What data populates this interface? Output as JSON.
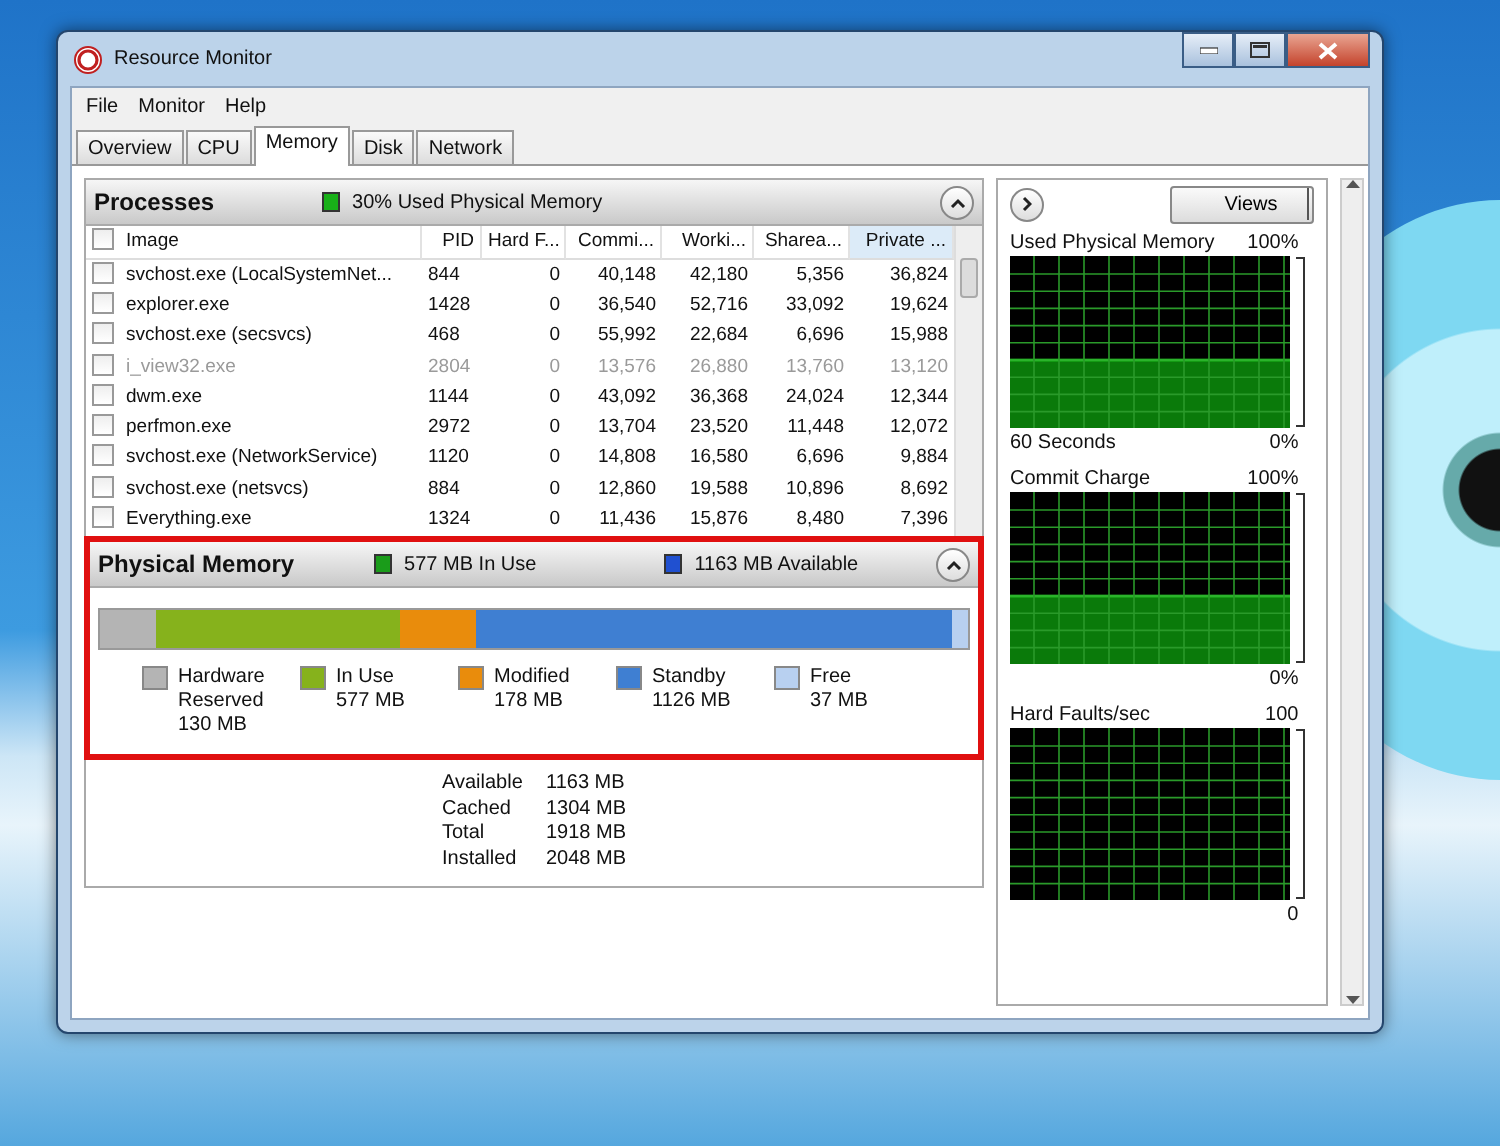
{
  "window": {
    "title": "Resource Monitor"
  },
  "menu": [
    "File",
    "Monitor",
    "Help"
  ],
  "tabs": [
    {
      "label": "Overview",
      "selected": false
    },
    {
      "label": "CPU",
      "selected": false
    },
    {
      "label": "Memory",
      "selected": true
    },
    {
      "label": "Disk",
      "selected": false
    },
    {
      "label": "Network",
      "selected": false
    }
  ],
  "processes": {
    "title": "Processes",
    "indicator": "30% Used Physical Memory",
    "select_all_checked": false,
    "columns": [
      {
        "label": "Image",
        "sorted": false
      },
      {
        "label": "PID",
        "sorted": false
      },
      {
        "label": "Hard F...",
        "sorted": false
      },
      {
        "label": "Commi...",
        "sorted": false
      },
      {
        "label": "Worki...",
        "sorted": false
      },
      {
        "label": "Sharea...",
        "sorted": false
      },
      {
        "label": "Private ...",
        "sorted": true
      }
    ],
    "rows": [
      {
        "checked": false,
        "disabled": false,
        "cells": [
          "svchost.exe (LocalSystemNet...",
          "844",
          "0",
          "40,148",
          "42,180",
          "5,356",
          "36,824"
        ]
      },
      {
        "checked": false,
        "disabled": false,
        "cells": [
          "explorer.exe",
          "1428",
          "0",
          "36,540",
          "52,716",
          "33,092",
          "19,624"
        ]
      },
      {
        "checked": false,
        "disabled": false,
        "cells": [
          "svchost.exe (secsvcs)",
          "468",
          "0",
          "55,992",
          "22,684",
          "6,696",
          "15,988"
        ]
      },
      {
        "checked": false,
        "disabled": true,
        "cells": [
          "i_view32.exe",
          "2804",
          "0",
          "13,576",
          "26,880",
          "13,760",
          "13,120"
        ]
      },
      {
        "checked": false,
        "disabled": false,
        "cells": [
          "dwm.exe",
          "1144",
          "0",
          "43,092",
          "36,368",
          "24,024",
          "12,344"
        ]
      },
      {
        "checked": false,
        "disabled": false,
        "cells": [
          "perfmon.exe",
          "2972",
          "0",
          "13,704",
          "23,520",
          "11,448",
          "12,072"
        ]
      },
      {
        "checked": false,
        "disabled": false,
        "cells": [
          "svchost.exe (NetworkService)",
          "1120",
          "0",
          "14,808",
          "16,580",
          "6,696",
          "9,884"
        ]
      },
      {
        "checked": false,
        "disabled": false,
        "cells": [
          "svchost.exe (netsvcs)",
          "884",
          "0",
          "12,860",
          "19,588",
          "10,896",
          "8,692"
        ]
      },
      {
        "checked": false,
        "disabled": false,
        "cells": [
          "Everything.exe",
          "1324",
          "0",
          "11,436",
          "15,876",
          "8,480",
          "7,396"
        ]
      }
    ]
  },
  "physical_memory": {
    "title": "Physical Memory",
    "indicators": [
      {
        "text": "577 MB In Use",
        "color": "#1a9c1a"
      },
      {
        "text": "1163 MB Available",
        "color": "#2050d0"
      }
    ],
    "segments": [
      {
        "label": "Hardware Reserved",
        "value": "130 MB",
        "color": "#b4b4b4"
      },
      {
        "label": "In Use",
        "value": "577 MB",
        "color": "#86b21c"
      },
      {
        "label": "Modified",
        "value": "178 MB",
        "color": "#e98c0c"
      },
      {
        "label": "Standby",
        "value": "1126 MB",
        "color": "#3f7fd2"
      },
      {
        "label": "Free",
        "value": "37 MB",
        "color": "#b8d0f0"
      }
    ],
    "stats": [
      {
        "label": "Available",
        "value": "1163 MB"
      },
      {
        "label": "Cached",
        "value": "1304 MB"
      },
      {
        "label": "Total",
        "value": "1918 MB"
      },
      {
        "label": "Installed",
        "value": "2048 MB"
      }
    ]
  },
  "graphs_panel": {
    "views_button": "Views",
    "graphs": [
      {
        "title": "Used Physical Memory",
        "max": "100%",
        "time": "60 Seconds",
        "min": "0%",
        "kind": "filled"
      },
      {
        "title": "Commit Charge",
        "max": "100%",
        "min": "0%",
        "kind": "filled"
      },
      {
        "title": "Hard Faults/sec",
        "max": "100",
        "min": "0",
        "kind": "empty"
      }
    ]
  }
}
